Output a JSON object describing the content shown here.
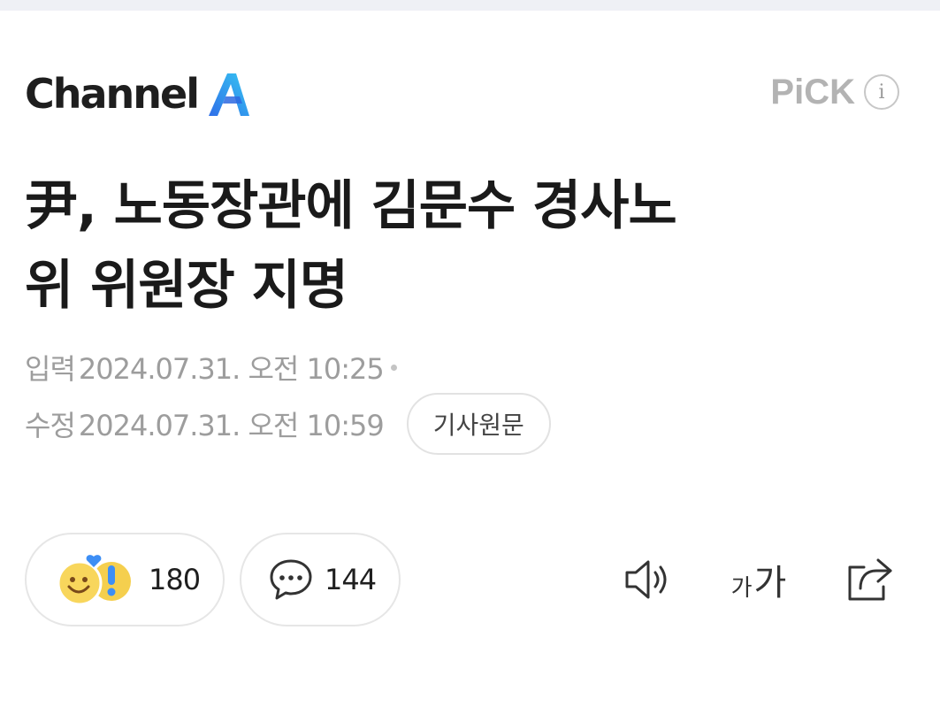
{
  "brand": {
    "name": "Channel",
    "icon": "channel-a-logo"
  },
  "pick": {
    "label": "PiCK",
    "info_icon": "info-icon",
    "info_glyph": "i"
  },
  "article": {
    "headline_line1": "尹, 노동장관에 김문수 경사노",
    "headline_line2": "위 위원장 지명",
    "input_label": "입력",
    "input_datetime": "2024.07.31. 오전 10:25",
    "modified_label": "수정",
    "modified_datetime": "2024.07.31. 오전 10:59",
    "source_button": "기사원문"
  },
  "engagement": {
    "reaction_icon": "emoji-reaction-icon",
    "reaction_count": "180",
    "comment_icon": "comment-bubble-icon",
    "comment_count": "144"
  },
  "toolbar": {
    "speaker_icon": "speaker-icon",
    "font_small": "가",
    "font_large": "가",
    "share_icon": "share-icon"
  },
  "colors": {
    "logo_blue": "#3b7bf5",
    "logo_cyan": "#38c8f0",
    "pick_gray": "#b3b3b3",
    "meta_gray": "#9d9d9d",
    "emoji_yellow": "#f8d65c",
    "heart_blue": "#3d8ef5"
  }
}
